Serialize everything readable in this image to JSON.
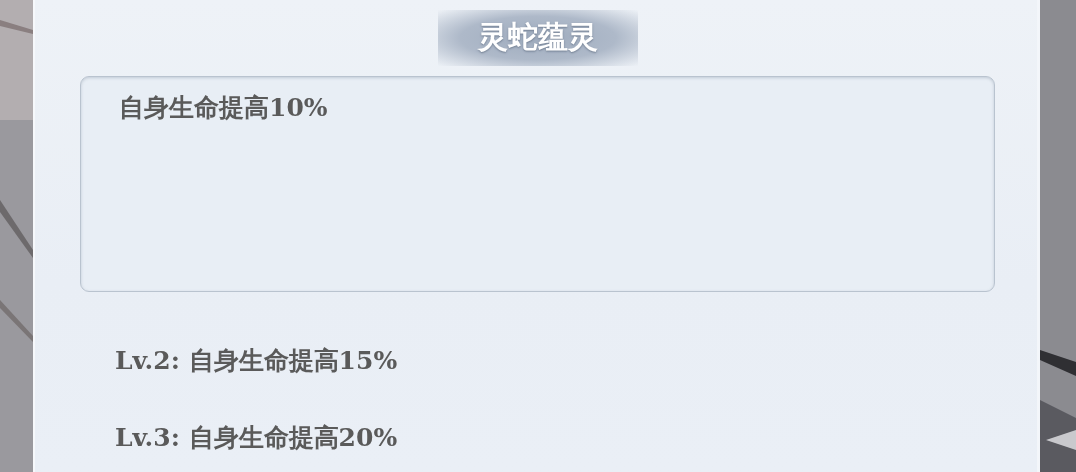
{
  "dialog": {
    "title": "灵蛇蕴灵",
    "current_effect": "自身生命提高10%",
    "levels": [
      {
        "text": "Lv.2: 自身生命提高15%"
      },
      {
        "text": "Lv.3: 自身生命提高20%"
      }
    ]
  }
}
